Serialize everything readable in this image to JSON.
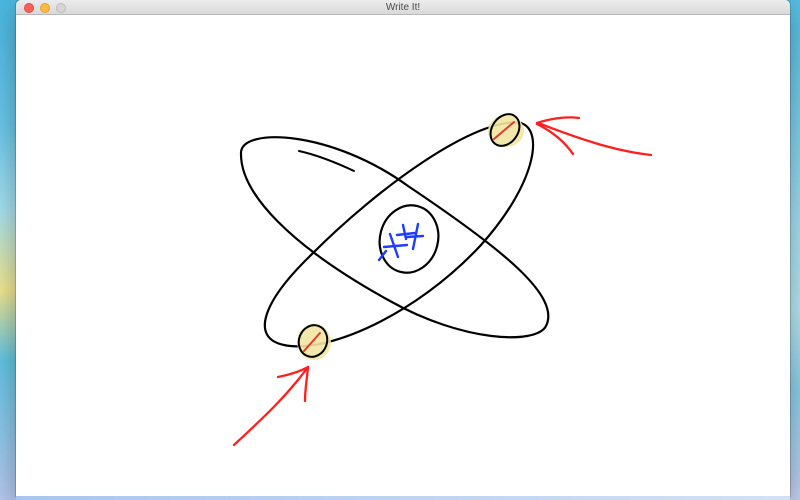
{
  "window": {
    "title": "Write It!",
    "buttons": {
      "close": "close",
      "minimize": "minimize",
      "zoom": "zoom"
    }
  },
  "canvas": {
    "background": "#ffffff",
    "ink_colors": {
      "black": "#000000",
      "blue": "#1f3cff",
      "red": "#ff1f1f",
      "highlight": "#f2e6a3"
    }
  }
}
